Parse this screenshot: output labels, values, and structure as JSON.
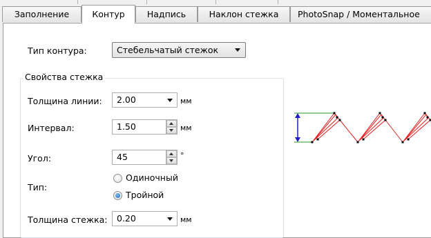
{
  "tabs": [
    {
      "label": "Заполнение",
      "active": false
    },
    {
      "label": "Контур",
      "active": true
    },
    {
      "label": "Надпись",
      "active": false
    },
    {
      "label": "Наклон стежка",
      "active": false
    },
    {
      "label": "PhotoSnap / Моментальное",
      "active": false
    }
  ],
  "contour": {
    "type_label": "Тип контура:",
    "type_value": "Стебельчатый стежок"
  },
  "stitch_props": {
    "title": "Свойства стежка",
    "line_thickness": {
      "label": "Толщина линии:",
      "value": "2.00",
      "unit": "мм"
    },
    "interval": {
      "label": "Интервал:",
      "value": "1.50",
      "unit": "мм"
    },
    "angle": {
      "label": "Угол:",
      "value": "45",
      "unit": "°"
    },
    "type": {
      "label": "Тип:",
      "options": [
        {
          "label": "Одиночный",
          "selected": false
        },
        {
          "label": "Тройной",
          "selected": true
        }
      ]
    },
    "stitch_thickness": {
      "label": "Толщина стежка:",
      "value": "0.20",
      "unit": "мм"
    }
  },
  "preview": {
    "stitch_color": "#e82020",
    "dimension_color": "#1e1ec8",
    "guide_color": "#2a9a2a"
  }
}
